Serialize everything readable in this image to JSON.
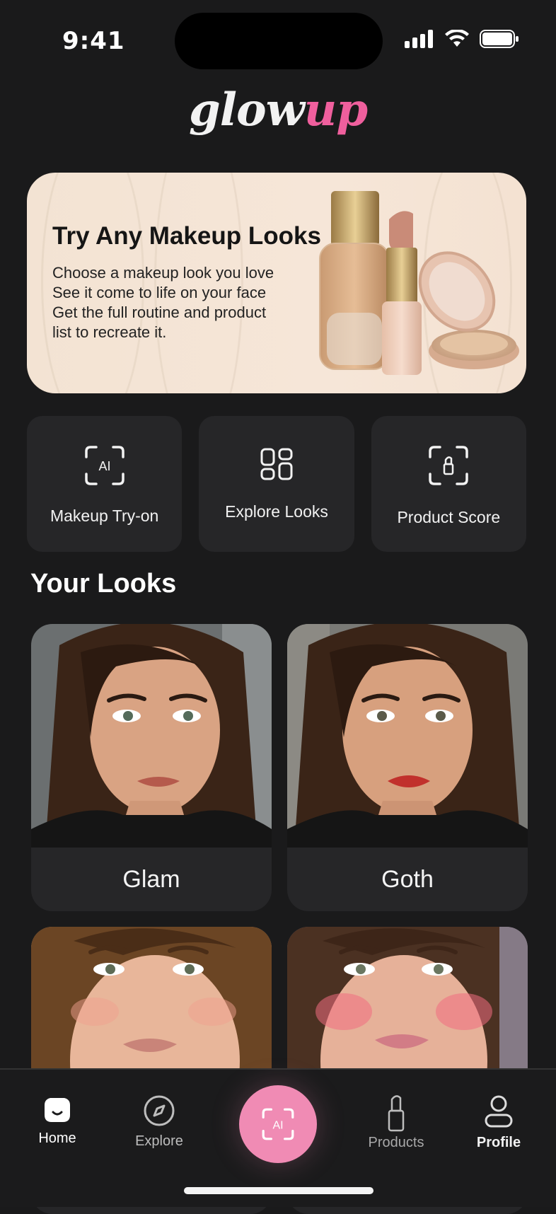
{
  "status": {
    "time": "9:41"
  },
  "app": {
    "logo_part1": "glow",
    "logo_part2": "up",
    "accent": "#ef5f9d"
  },
  "hero": {
    "title": "Try Any Makeup Looks",
    "lines": [
      "Choose a makeup look you love",
      "See it come to life on your face",
      "Get the full routine and product",
      "list to recreate it."
    ]
  },
  "quick_actions": [
    {
      "label": "Makeup Try-on",
      "icon": "ai-scan-icon",
      "icon_text": "AI"
    },
    {
      "label": "Explore Looks",
      "icon": "grid-icon"
    },
    {
      "label": "Product Score",
      "icon": "lipstick-scan-icon"
    }
  ],
  "looks": {
    "title": "Your Looks",
    "items": [
      {
        "name": "Glam"
      },
      {
        "name": "Goth"
      },
      {
        "name": ""
      },
      {
        "name": ""
      }
    ]
  },
  "nav": {
    "items": [
      {
        "label": "Home",
        "icon": "home-icon",
        "active": true
      },
      {
        "label": "Explore",
        "icon": "compass-icon"
      },
      {
        "label": "Products",
        "icon": "lipstick-icon"
      },
      {
        "label": "Profile",
        "icon": "profile-icon"
      }
    ],
    "center_icon_text": "AI",
    "center_color": "#f08bb4"
  }
}
